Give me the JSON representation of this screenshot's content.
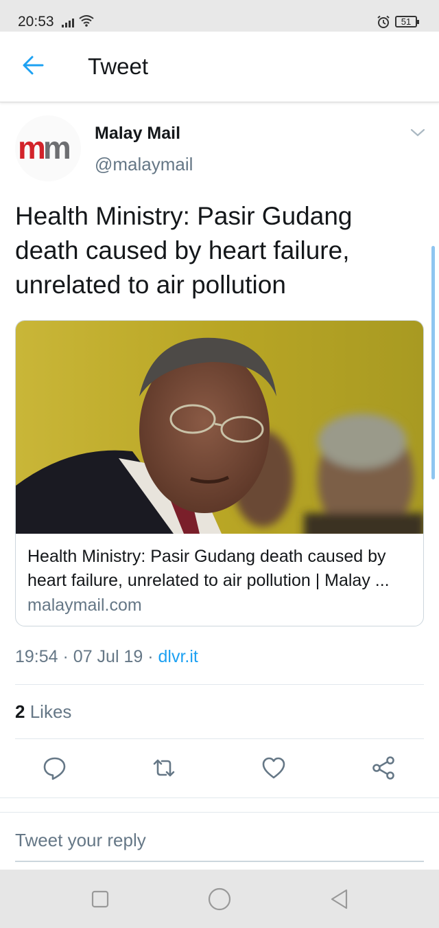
{
  "status_bar": {
    "time": "20:53",
    "battery": "51"
  },
  "header": {
    "title": "Tweet"
  },
  "tweet": {
    "author_name": "Malay Mail",
    "author_handle": "@malaymail",
    "avatar_text_1": "m",
    "avatar_text_2": "m",
    "text": "Health Ministry: Pasir Gudang death caused by heart failure, unrelated to air pollution",
    "card": {
      "title": "Health Ministry: Pasir Gudang death caused by heart failure, unrelated to air pollution | Malay ...",
      "domain": "malaymail.com"
    },
    "time": "19:54",
    "date": "07 Jul 19",
    "separator": "·",
    "source": "dlvr.it",
    "likes_count": "2",
    "likes_label": "Likes"
  },
  "reply": {
    "placeholder": "Tweet your reply"
  },
  "colors": {
    "accent": "#1da1f2",
    "text": "#14171a",
    "secondary": "#657786",
    "brand_red": "#d2232a"
  }
}
